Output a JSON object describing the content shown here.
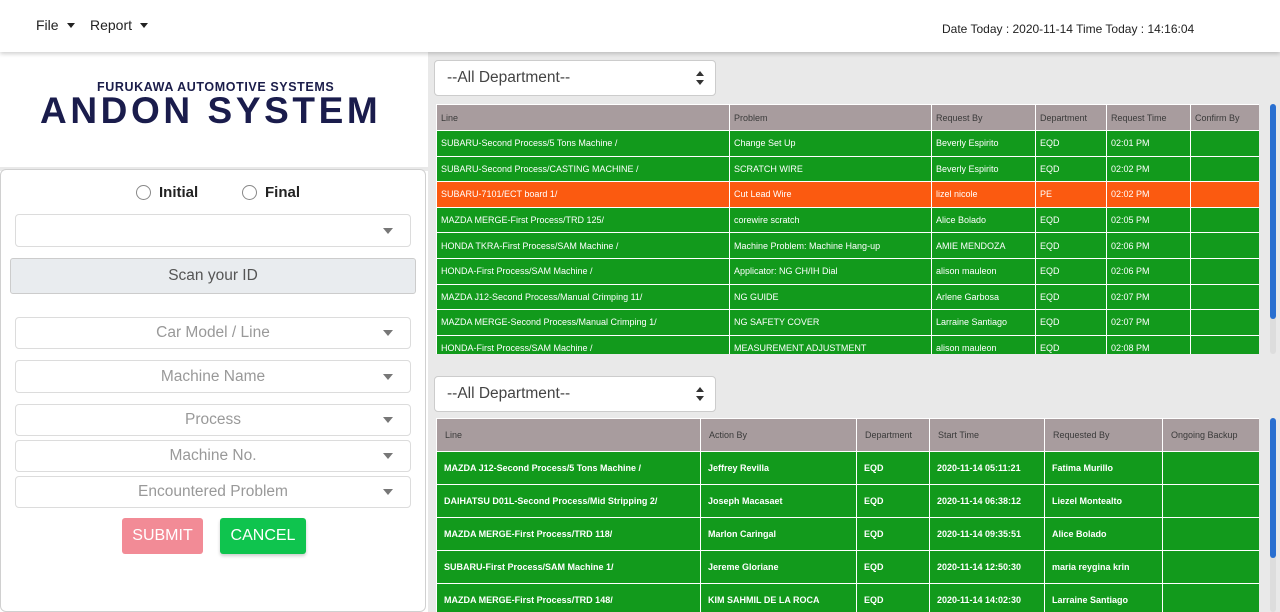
{
  "navbar": {
    "file_label": "File",
    "report_label": "Report",
    "datetime": "Date Today : 2020-11-14 Time Today : 14:16:04"
  },
  "logo": {
    "subtitle": "FURUKAWA AUTOMOTIVE SYSTEMS",
    "title": "ANDON SYSTEM"
  },
  "form": {
    "radio_initial": "Initial",
    "radio_final": "Final",
    "top_select": "",
    "scan_label": "Scan your ID",
    "car_model": "Car Model / Line",
    "machine_name": "Machine Name",
    "process": "Process",
    "machine_no": "Machine No.",
    "problem": "Encountered Problem",
    "submit": "SUBMIT",
    "cancel": "CANCEL"
  },
  "requests": {
    "department_filter": "--All Department--",
    "headers": [
      "Line",
      "Problem",
      "Request By",
      "Department",
      "Request Time",
      "Confirm By"
    ],
    "rows": [
      {
        "status": "green",
        "cells": [
          "SUBARU-Second Process/5 Tons Machine /",
          "Change Set Up",
          "Beverly Espirito",
          "EQD",
          "02:01 PM",
          ""
        ]
      },
      {
        "status": "green",
        "cells": [
          "SUBARU-Second Process/CASTING MACHINE /",
          "SCRATCH WIRE",
          "Beverly Espirito",
          "EQD",
          "02:02 PM",
          ""
        ]
      },
      {
        "status": "orange",
        "cells": [
          "SUBARU-7101/ECT board 1/",
          "Cut Lead Wire",
          "lizel nicole",
          "PE",
          "02:02 PM",
          ""
        ]
      },
      {
        "status": "green",
        "cells": [
          "MAZDA MERGE-First Process/TRD 125/",
          "corewire scratch",
          "Alice Bolado",
          "EQD",
          "02:05 PM",
          ""
        ]
      },
      {
        "status": "green",
        "cells": [
          "HONDA TKRA-First Process/SAM Machine /",
          "Machine Problem: Machine Hang-up",
          "AMIE MENDOZA",
          "EQD",
          "02:06 PM",
          ""
        ]
      },
      {
        "status": "green",
        "cells": [
          "HONDA-First Process/SAM Machine /",
          "Applicator: NG CH/IH Dial",
          "alison mauleon",
          "EQD",
          "02:06 PM",
          ""
        ]
      },
      {
        "status": "green",
        "cells": [
          "MAZDA J12-Second Process/Manual Crimping 11/",
          "NG GUIDE",
          "Arlene Garbosa",
          "EQD",
          "02:07 PM",
          ""
        ]
      },
      {
        "status": "green",
        "cells": [
          "MAZDA MERGE-Second Process/Manual Crimping 1/",
          "NG SAFETY COVER",
          "Larraine Santiago",
          "EQD",
          "02:07 PM",
          ""
        ]
      },
      {
        "status": "green",
        "cells": [
          "HONDA-First Process/SAM Machine /",
          "MEASUREMENT ADJUSTMENT",
          "alison mauleon",
          "EQD",
          "02:08 PM",
          ""
        ]
      }
    ]
  },
  "ongoing": {
    "department_filter": "--All Department--",
    "headers": [
      "Line",
      "Action By",
      "Department",
      "Start Time",
      "Requested By",
      "Ongoing Backup"
    ],
    "rows": [
      {
        "status": "green",
        "cells": [
          "MAZDA J12-Second Process/5 Tons Machine /",
          "Jeffrey Revilla",
          "EQD",
          "2020-11-14 05:11:21",
          "Fatima Murillo",
          ""
        ]
      },
      {
        "status": "green",
        "cells": [
          "DAIHATSU D01L-Second Process/Mid Stripping 2/",
          "Joseph Macasaet",
          "EQD",
          "2020-11-14 06:38:12",
          "Liezel Montealto",
          ""
        ]
      },
      {
        "status": "green",
        "cells": [
          "MAZDA MERGE-First Process/TRD 118/",
          "Marlon Caringal",
          "EQD",
          "2020-11-14 09:35:51",
          "Alice Bolado",
          ""
        ]
      },
      {
        "status": "green",
        "cells": [
          "SUBARU-First Process/SAM Machine 1/",
          "Jereme Gloriane",
          "EQD",
          "2020-11-14 12:50:30",
          "maria reygina krin",
          ""
        ]
      },
      {
        "status": "green",
        "cells": [
          "MAZDA MERGE-First Process/TRD 148/",
          "KIM SAHMIL DE LA ROCA",
          "EQD",
          "2020-11-14 14:02:30",
          "Larraine Santiago",
          ""
        ]
      }
    ]
  },
  "colors": {
    "row_green": "#129a1c",
    "row_orange": "#fb5a10",
    "header_bg": "#a89c9e",
    "submit_bg": "#f28b96",
    "cancel_bg": "#0fc44e",
    "scroll_thumb": "#2a6fd0"
  }
}
